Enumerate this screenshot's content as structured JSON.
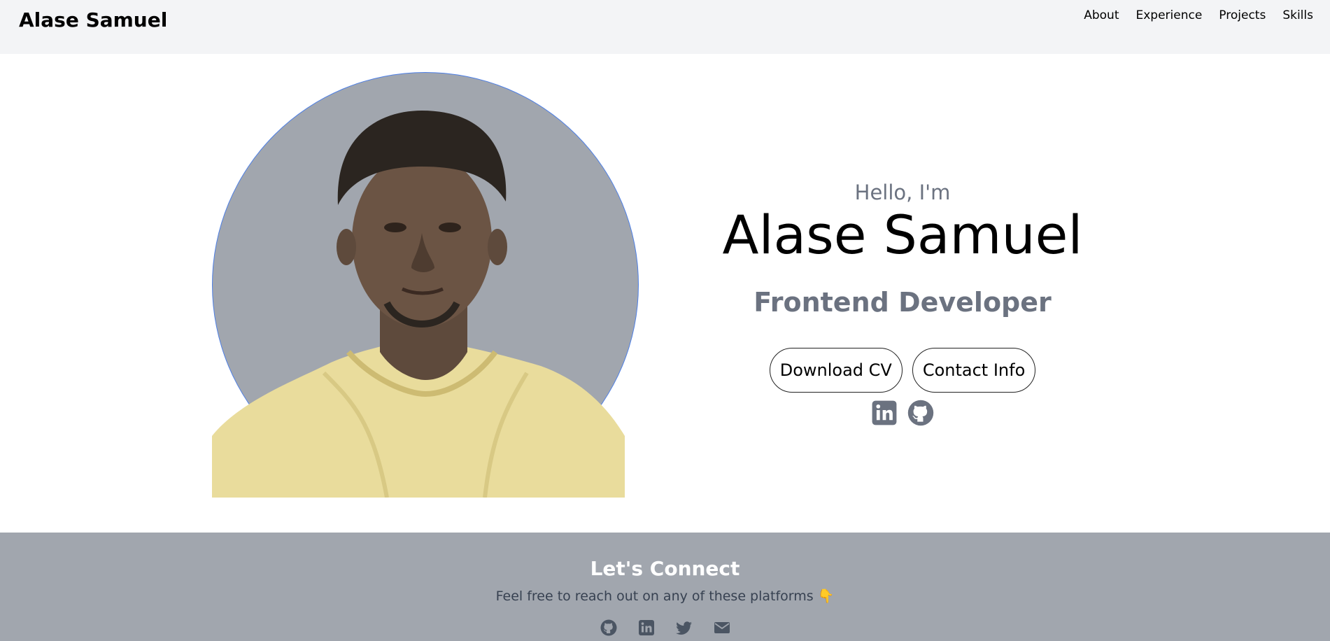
{
  "nav": {
    "brand": "Alase Samuel",
    "links": [
      "About",
      "Experience",
      "Projects",
      "Skills"
    ]
  },
  "hero": {
    "greeting": "Hello, I'm",
    "name": "Alase Samuel",
    "role": "Frontend Developer",
    "buttons": {
      "download_cv": "Download CV",
      "contact_info": "Contact Info"
    },
    "social_icons": [
      "linkedin-icon",
      "github-icon"
    ],
    "portrait_alt": "profile-picture"
  },
  "footer": {
    "title": "Let's Connect",
    "subtitle": "Feel free to reach out on any of these platforms 👇",
    "icons": [
      "github-icon",
      "linkedin-icon",
      "twitter-icon",
      "email-icon"
    ]
  },
  "colors": {
    "nav_bg": "#f3f4f6",
    "footer_bg": "#a1a6ae",
    "muted_text": "#6b7280",
    "portrait_ring": "#4d7fe6"
  }
}
